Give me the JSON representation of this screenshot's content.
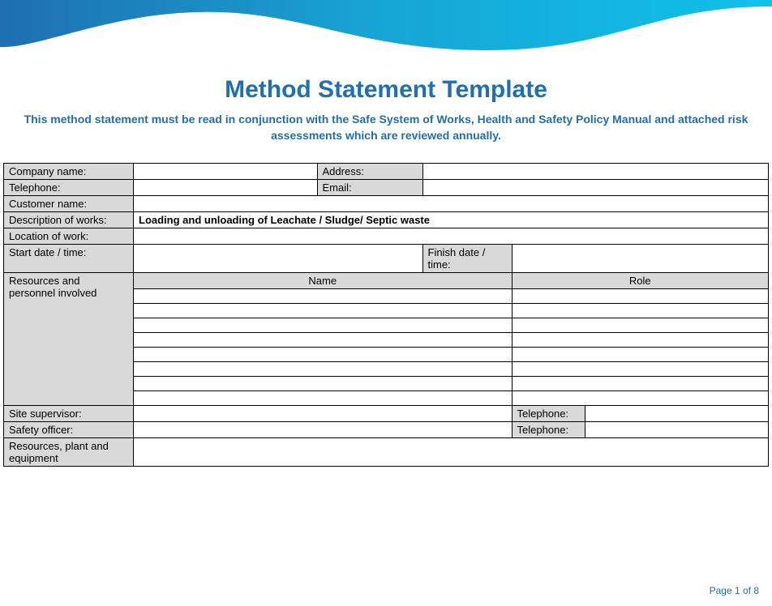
{
  "title": "Method Statement Template",
  "subtitle": "This method statement must be read in conjunction with the Safe System of Works, Health and Safety Policy Manual and attached risk assessments which are reviewed annually.",
  "labels": {
    "company_name": "Company name:",
    "address": "Address:",
    "telephone": "Telephone:",
    "email": "Email:",
    "customer_name": "Customer name:",
    "description_of_works": "Description of works:",
    "location_of_work": "Location of work:",
    "start_date_time": "Start date / time:",
    "finish_date_time": "Finish date / time:",
    "resources_personnel": "Resources and personnel involved",
    "name_header": "Name",
    "role_header": "Role",
    "site_supervisor": "Site supervisor:",
    "safety_officer": "Safety officer:",
    "telephone2": "Telephone:",
    "resources_plant": "Resources, plant and equipment"
  },
  "values": {
    "company_name": "",
    "address": "",
    "telephone": "",
    "email": "",
    "customer_name": "",
    "description_of_works": "Loading and unloading of Leachate / Sludge/ Septic waste",
    "location_of_work": "",
    "start_date_time": "",
    "finish_date_time": "",
    "site_supervisor": "",
    "site_supervisor_tel": "",
    "safety_officer": "",
    "safety_officer_tel": "",
    "resources_plant": ""
  },
  "personnel_rows": [
    {
      "name": "",
      "role": ""
    },
    {
      "name": "",
      "role": ""
    },
    {
      "name": "",
      "role": ""
    },
    {
      "name": "",
      "role": ""
    },
    {
      "name": "",
      "role": ""
    },
    {
      "name": "",
      "role": ""
    },
    {
      "name": "",
      "role": ""
    },
    {
      "name": "",
      "role": ""
    }
  ],
  "footer": "Page 1 of 8"
}
